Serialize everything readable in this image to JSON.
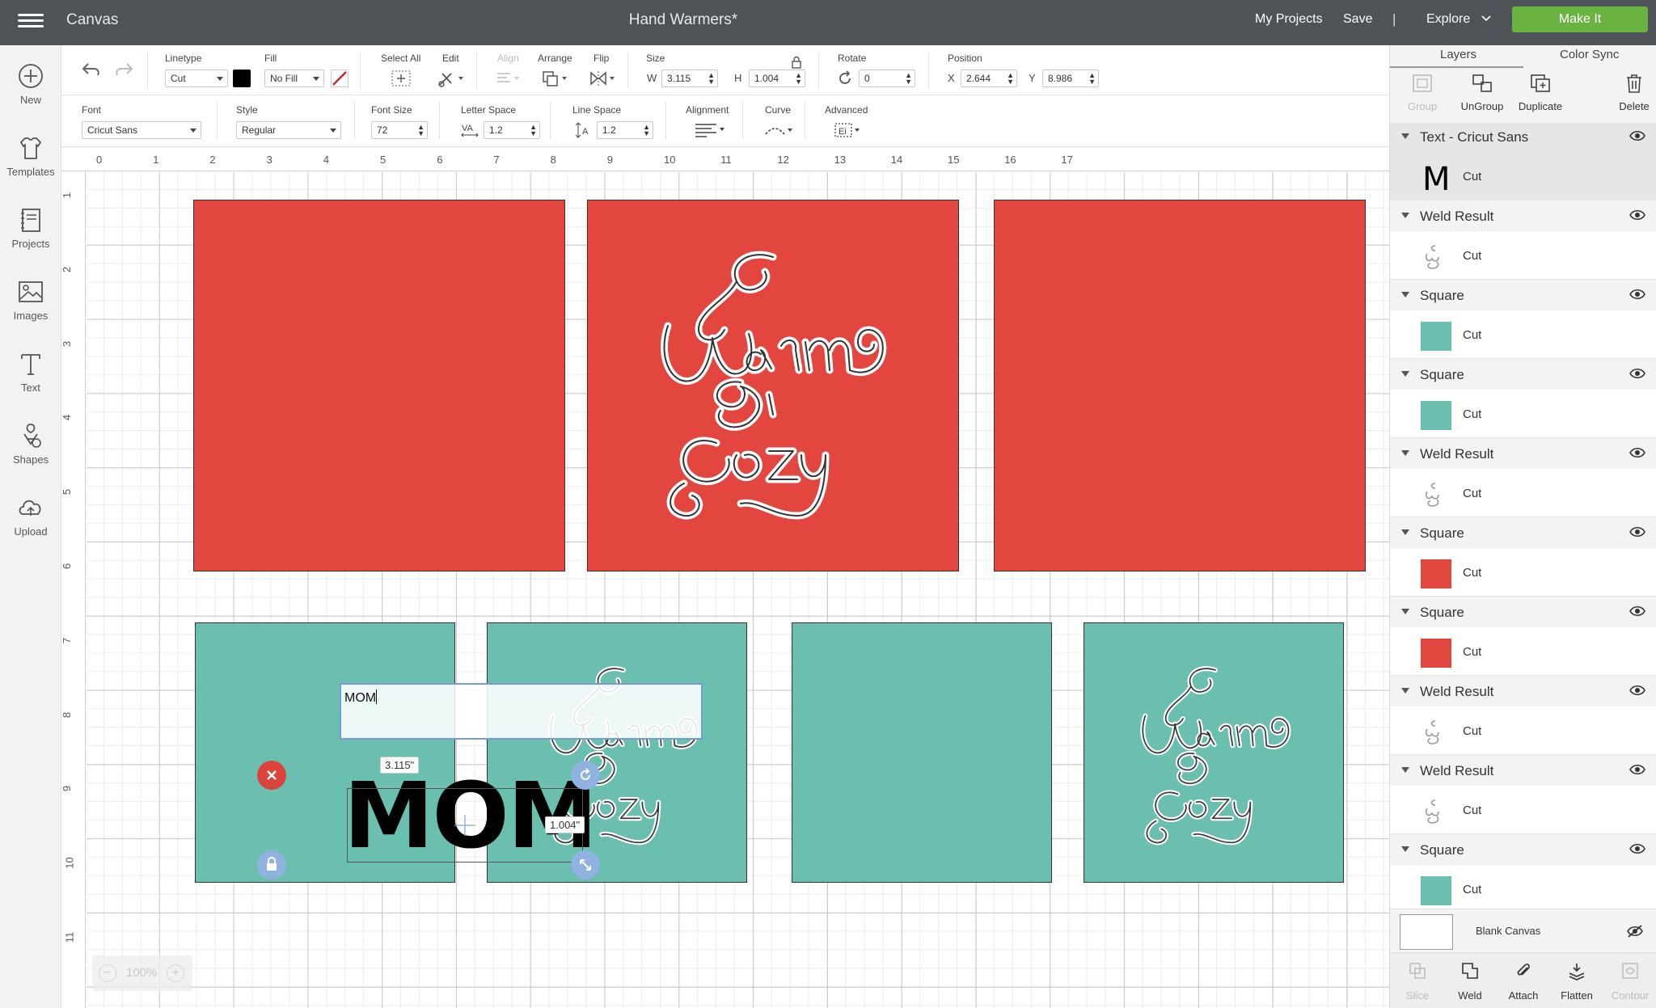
{
  "header": {
    "app_title": "Canvas",
    "doc_title": "Hand Warmers*",
    "my_projects": "My Projects",
    "save": "Save",
    "separator": "|",
    "explore": "Explore",
    "make_it": "Make It",
    "make_it_color": "#6ab343"
  },
  "sidebar": {
    "items": [
      {
        "label": "New",
        "icon": "plus-circle-icon"
      },
      {
        "label": "Templates",
        "icon": "shirt-icon"
      },
      {
        "label": "Projects",
        "icon": "notebook-icon"
      },
      {
        "label": "Images",
        "icon": "image-icon"
      },
      {
        "label": "Text",
        "icon": "text-t-icon"
      },
      {
        "label": "Shapes",
        "icon": "shapes-icon"
      },
      {
        "label": "Upload",
        "icon": "cloud-upload-icon"
      }
    ]
  },
  "toolbar": {
    "linetype_label": "Linetype",
    "linetype_value": "Cut",
    "fill_label": "Fill",
    "fill_value": "No Fill",
    "select_all_label": "Select All",
    "edit_label": "Edit",
    "align_label": "Align",
    "arrange_label": "Arrange",
    "flip_label": "Flip",
    "size_label": "Size",
    "w_label": "W",
    "w_value": "3.115",
    "h_label": "H",
    "h_value": "1.004",
    "rotate_label": "Rotate",
    "rotate_value": "0",
    "position_label": "Position",
    "x_label": "X",
    "x_value": "2.644",
    "y_label": "Y",
    "y_value": "8.986"
  },
  "text_toolbar": {
    "font_label": "Font",
    "font_value": "Cricut Sans",
    "style_label": "Style",
    "style_value": "Regular",
    "font_size_label": "Font Size",
    "font_size_value": "72",
    "letter_space_label": "Letter Space",
    "letter_space_value": "1.2",
    "line_space_label": "Line Space",
    "line_space_value": "1.2",
    "alignment_label": "Alignment",
    "curve_label": "Curve",
    "advanced_label": "Advanced"
  },
  "canvas": {
    "ruler_top": [
      "0",
      "1",
      "2",
      "3",
      "4",
      "5",
      "6",
      "7",
      "8",
      "9",
      "10",
      "11",
      "12",
      "13",
      "14",
      "15",
      "16",
      "17"
    ],
    "ruler_left": [
      "1",
      "2",
      "3",
      "4",
      "5",
      "6",
      "7",
      "8",
      "9",
      "10",
      "11"
    ],
    "text_input": "MOM",
    "selected_text": "MOM",
    "width_readout": "3.115\"",
    "height_readout": "1.004\"",
    "zoom_minus": "−",
    "zoom_value": "100%",
    "zoom_plus": "+",
    "colors": {
      "red": "#e2463e",
      "teal": "#6bbfae"
    }
  },
  "layers_panel": {
    "tabs": [
      "Layers",
      "Color Sync"
    ],
    "actions": [
      {
        "label": "Group",
        "enabled": false
      },
      {
        "label": "UnGroup",
        "enabled": true
      },
      {
        "label": "Duplicate",
        "enabled": true
      },
      {
        "label": "Delete",
        "enabled": true
      }
    ],
    "layers": [
      {
        "name": "Text - Cricut Sans",
        "op": "Cut",
        "thumb": "text-m",
        "color": "#000000"
      },
      {
        "name": "Weld Result",
        "op": "Cut",
        "thumb": "warm-cozy",
        "color": "#ffffff"
      },
      {
        "name": "Square",
        "op": "Cut",
        "thumb": "swatch",
        "color": "#6bbfae"
      },
      {
        "name": "Square",
        "op": "Cut",
        "thumb": "swatch",
        "color": "#6bbfae"
      },
      {
        "name": "Weld Result",
        "op": "Cut",
        "thumb": "warm-cozy",
        "color": "#ffffff"
      },
      {
        "name": "Square",
        "op": "Cut",
        "thumb": "swatch",
        "color": "#e2463e"
      },
      {
        "name": "Square",
        "op": "Cut",
        "thumb": "swatch",
        "color": "#e2463e"
      },
      {
        "name": "Weld Result",
        "op": "Cut",
        "thumb": "warm-cozy",
        "color": "#ffffff"
      },
      {
        "name": "Weld Result",
        "op": "Cut",
        "thumb": "warm-cozy",
        "color": "#ffffff"
      },
      {
        "name": "Square",
        "op": "Cut",
        "thumb": "swatch",
        "color": "#6bbfae"
      }
    ],
    "blank_canvas": "Blank Canvas",
    "bottom_actions": [
      {
        "label": "Slice",
        "enabled": false
      },
      {
        "label": "Weld",
        "enabled": true
      },
      {
        "label": "Attach",
        "enabled": true
      },
      {
        "label": "Flatten",
        "enabled": true
      },
      {
        "label": "Contour",
        "enabled": false
      }
    ]
  }
}
